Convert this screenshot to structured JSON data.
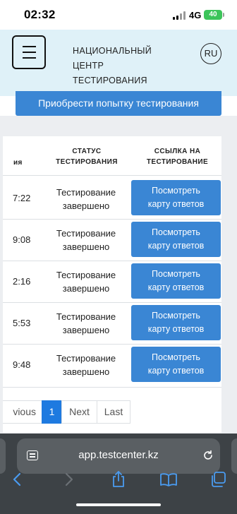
{
  "status_bar": {
    "time": "02:32",
    "network": "4G",
    "battery": "40"
  },
  "header": {
    "menu_icon": "hamburger-icon",
    "brand_lines": [
      "НАЦИОНАЛЬНЫЙ",
      "ЦЕНТР",
      "ТЕСТИРОВАНИЯ"
    ],
    "language": "RU"
  },
  "buy_button_label": "Приобрести попытку тестирования",
  "table": {
    "headers": {
      "time_partial": "ия",
      "status_line1": "СТАТУС",
      "status_line2": "ТЕСТИРОВАНИЯ",
      "link_line1": "ССЫЛКА НА",
      "link_line2": "ТЕСТИРОВАНИЕ"
    },
    "rows": [
      {
        "time": "7:22",
        "status_line1": "Тестирование",
        "status_line2": "завершено",
        "button_line1": "Посмотреть",
        "button_line2": "карту ответов"
      },
      {
        "time": "9:08",
        "status_line1": "Тестирование",
        "status_line2": "завершено",
        "button_line1": "Посмотреть",
        "button_line2": "карту ответов"
      },
      {
        "time": "2:16",
        "status_line1": "Тестирование",
        "status_line2": "завершено",
        "button_line1": "Посмотреть",
        "button_line2": "карту ответов"
      },
      {
        "time": "5:53",
        "status_line1": "Тестирование",
        "status_line2": "завершено",
        "button_line1": "Посмотреть",
        "button_line2": "карту ответов"
      },
      {
        "time": "9:48",
        "status_line1": "Тестирование",
        "status_line2": "завершено",
        "button_line1": "Посмотреть",
        "button_line2": "карту ответов"
      }
    ]
  },
  "pagination": {
    "previous": "vious",
    "current": "1",
    "next": "Next",
    "last": "Last"
  },
  "browser": {
    "url": "app.testcenter.kz",
    "icons": [
      "page-settings-icon",
      "reload-icon",
      "back-icon",
      "forward-icon",
      "share-icon",
      "bookmarks-icon",
      "tabs-icon"
    ]
  },
  "colors": {
    "accent": "#3a86d4",
    "header_bg": "#dff1f8",
    "active_page": "#1e7ae0",
    "browser_bar": "#3d4246"
  }
}
